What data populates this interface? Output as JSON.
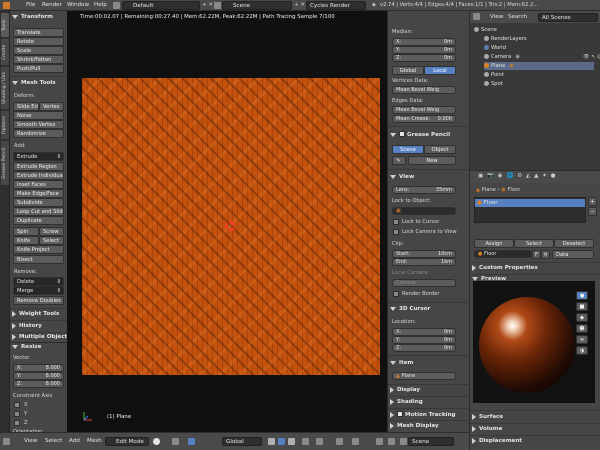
{
  "topbar": {
    "menus": [
      "File",
      "Render",
      "Window",
      "Help"
    ],
    "layout": "Default",
    "scene": "Scene",
    "engine": "Cycles Render",
    "stats": "v2.74 | Verts:4/4 | Edges:4/4 | Faces:1/1 | Tris:2 | Mem:62.2..."
  },
  "left_tabs": [
    "Tools",
    "Create",
    "Shading / UVs",
    "Options",
    "Grease Pencil"
  ],
  "tool_shelf": {
    "transform": {
      "title": "Transform",
      "buttons": [
        "Translate",
        "Rotate",
        "Scale",
        "Shrink/Fatten",
        "Push/Pull"
      ]
    },
    "mesh_tools": {
      "title": "Mesh Tools",
      "deform_label": "Deform:",
      "slide_edge": "Slide Ed",
      "vertex": "Vertex",
      "buttons1": [
        "Noise",
        "Smooth Vertex",
        "Randomize"
      ],
      "add_label": "Add:",
      "extrude": "Extrude",
      "buttons2": [
        "Extrude Region",
        "Extrude Individual",
        "Inset Faces",
        "Make Edge/Face",
        "Subdivide",
        "Loop Cut and Slide",
        "Duplicate"
      ],
      "spin": "Spin",
      "screw": "Screw",
      "knife": "Knife",
      "select": "Select",
      "knife_project": "Knife Project",
      "bisect": "Bisect",
      "remove_label": "Remove:",
      "delete": "Delete",
      "merge": "Merge",
      "remove_doubles": "Remove Doubles"
    },
    "collapsed": [
      "Weight Tools",
      "History",
      "Multiple Objects"
    ]
  },
  "redo_panel": {
    "title": "Resize",
    "vector_label": "Vector",
    "x_label": "X:",
    "x_value": "8.000",
    "y_label": "Y:",
    "y_value": "8.000",
    "z_label": "Z:",
    "z_value": "8.000",
    "constraint_label": "Constraint Axis",
    "cx": "X",
    "cy": "Y",
    "cz": "Z",
    "orientation_label": "Orientation"
  },
  "viewport": {
    "info": "Time:00:02.07 | Remaining:00:27.40 | Mem:62.22M, Peak:62.22M | Path Tracing Sample 7/100",
    "object_name": "(1) Plane"
  },
  "bottombar": {
    "view": "View",
    "select": "Select",
    "add": "Add",
    "mesh": "Mesh",
    "mode": "Edit Mode",
    "orientation": "Global"
  },
  "npanel": {
    "median_label": "Median:",
    "x": "X:",
    "x_val": "0m",
    "y": "Y:",
    "y_val": "0m",
    "z": "Z:",
    "z_val": "0m",
    "global": "Global",
    "local": "Local",
    "vdata_label": "Vertices Data:",
    "mean_bevel_v": "Mean Bevel Weig",
    "mbv_val": "0.000",
    "edata_label": "Edges Data:",
    "mean_bevel_e": "Mean Bevel Weig",
    "mbe_val": "0.000",
    "mean_crease": "Mean Crease:",
    "mc_val": "0.000",
    "grease_pencil": "Grease Pencil",
    "gp_scene": "Scene",
    "gp_object": "Object",
    "gp_new": "New",
    "view_title": "View",
    "lens": "Lens:",
    "lens_val": "35mm",
    "lock_object": "Lock to Object:",
    "lock_cursor": "Lock to Cursor",
    "lock_camera": "Lock Camera to View",
    "clip_label": "Clip:",
    "start": "Start:",
    "start_val": "10cm",
    "end": "End:",
    "end_val": "1km",
    "local_camera": "Local Camera:",
    "camera": "Camera",
    "render_border": "Render Border",
    "cursor_title": "3D Cursor",
    "location": "Location:",
    "cx": "X:",
    "cx_val": "0m",
    "cy": "Y:",
    "cy_val": "0m",
    "cz": "Z:",
    "cz_val": "0m",
    "item_title": "Item",
    "item_name": "Plane",
    "display": "Display",
    "shading": "Shading",
    "motion_tracking": "Motion Tracking",
    "mesh_display": "Mesh Display"
  },
  "outliner": {
    "view": "View",
    "search": "Search",
    "all_scenes": "All Scenes",
    "items": [
      "Scene",
      "RenderLayers",
      "World",
      "Camera",
      "Plane",
      "Point",
      "Spot"
    ]
  },
  "properties": {
    "breadcrumb_obj": "Plane",
    "breadcrumb_mat": "Floor",
    "material_slot": "Floor",
    "assign": "Assign",
    "select": "Select",
    "deselect": "Deselect",
    "material_name": "Floor",
    "f_label": "F",
    "data": "Data",
    "custom_props": "Custom Properties",
    "preview": "Preview",
    "surface": "Surface",
    "volume": "Volume",
    "displacement": "Displacement"
  }
}
